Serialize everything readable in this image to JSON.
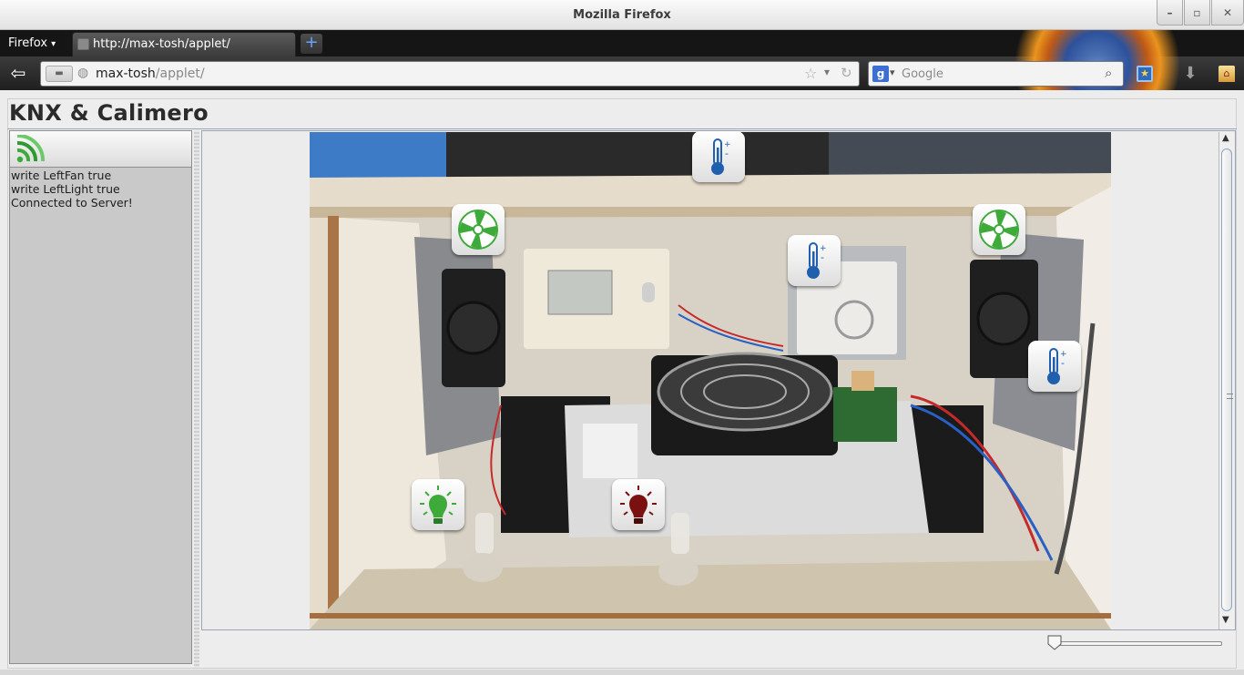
{
  "window": {
    "title": "Mozilla Firefox"
  },
  "browser": {
    "menu_label": "Firefox",
    "tab_title": "http://max-tosh/applet/",
    "url_host": "max-tosh",
    "url_path": "/applet/",
    "search_placeholder": "Google"
  },
  "page": {
    "heading": "KNX & Calimero",
    "log_lines": [
      "write LeftFan true",
      "write LeftLight true",
      "Connected to Server!"
    ]
  },
  "controls": {
    "thermostat_top": "thermometer-icon",
    "left_fan": "fan-icon",
    "right_fan": "fan-icon",
    "thermostat_center": "thermometer-icon",
    "thermostat_right": "thermometer-icon",
    "left_light": "bulb-on-icon",
    "right_light": "bulb-off-icon"
  },
  "colors": {
    "active_green": "#3daa3a",
    "inactive_red": "#7a1010",
    "thermo_blue": "#1f5fae"
  }
}
